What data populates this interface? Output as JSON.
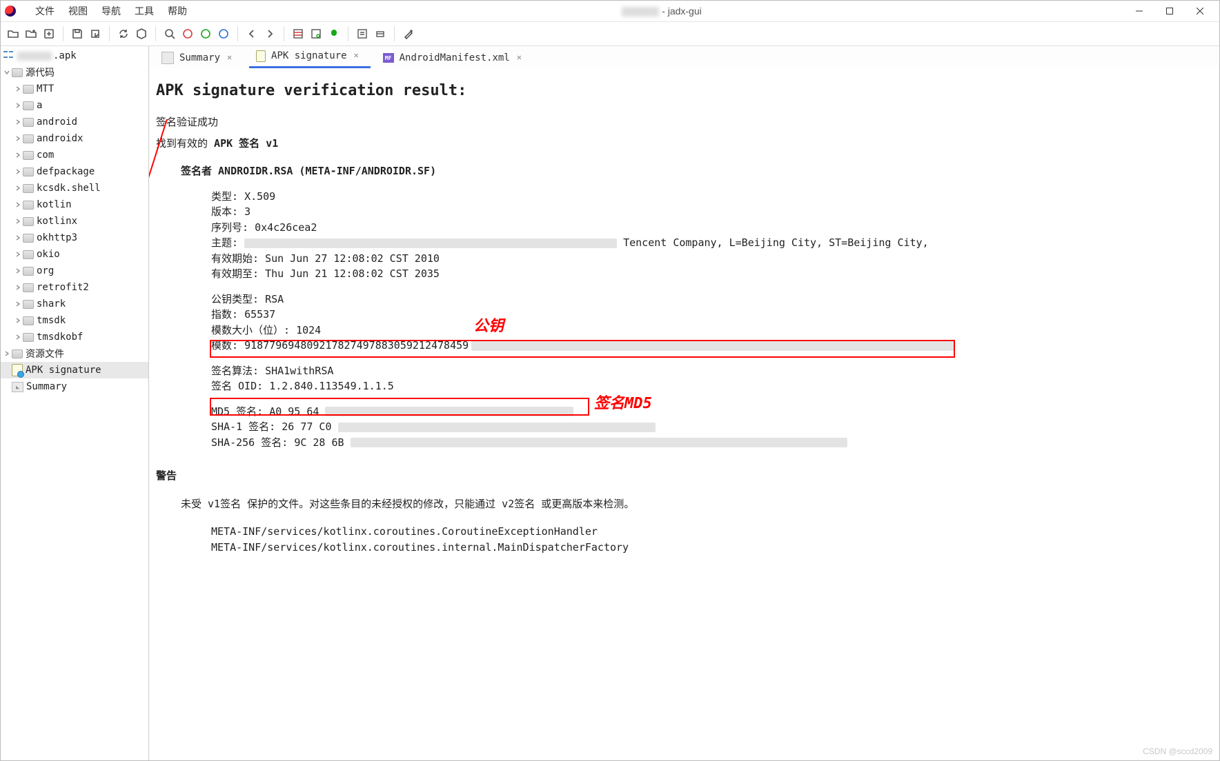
{
  "window": {
    "title_suffix": " - jadx-gui"
  },
  "menu": [
    "文件",
    "视图",
    "导航",
    "工具",
    "帮助"
  ],
  "tree": {
    "root_label": ".apk",
    "source_label": "源代码",
    "packages": [
      "MTT",
      "a",
      "android",
      "androidx",
      "com",
      "defpackage",
      "kcsdk.shell",
      "kotlin",
      "kotlinx",
      "okhttp3",
      "okio",
      "org",
      "retrofit2",
      "shark",
      "tmsdk",
      "tmsdkobf"
    ],
    "resources_label": "资源文件",
    "apk_sig_label": "APK signature",
    "summary_label": "Summary"
  },
  "tabs": [
    {
      "label": "Summary",
      "icon": "sum"
    },
    {
      "label": "APK signature",
      "icon": "cert",
      "active": true
    },
    {
      "label": "AndroidManifest.xml",
      "icon": "mf"
    }
  ],
  "page": {
    "title": "APK signature verification result:",
    "verify_ok": "签名验证成功",
    "found_prefix": "找到有效的 ",
    "found_bold": "APK 签名 v1",
    "signer_prefix": "签名者 ",
    "signer_name": "ANDROIDR.RSA (META-INF/ANDROIDR.SF)",
    "fields": {
      "type_label": "类型: ",
      "type_val": "X.509",
      "ver_label": "版本: ",
      "ver_val": "3",
      "serial_label": "序列号: ",
      "serial_val": "0x4c26cea2",
      "subject_label": "主题: ",
      "subject_tail": " Tencent Company, L=Beijing City, ST=Beijing City,",
      "valid_from_label": "有效期始: ",
      "valid_from_val": "Sun Jun 27 12:08:02 CST 2010",
      "valid_to_label": "有效期至: ",
      "valid_to_val": "Thu Jun 21 12:08:02 CST 2035",
      "pk_type_label": "公钥类型: ",
      "pk_type_val": "RSA",
      "exp_label": "指数: ",
      "exp_val": "65537",
      "mod_size_label": "模数大小（位）: ",
      "mod_size_val": "1024",
      "mod_label": "模数: ",
      "mod_val": "918779694809217827497883059212478459",
      "sig_alg_label": "签名算法: ",
      "sig_alg_val": "SHA1withRSA",
      "sig_oid_label": "签名 OID: ",
      "sig_oid_val": "1.2.840.113549.1.1.5",
      "md5_label": "MD5 签名: ",
      "md5_val": "A0 95 64 ",
      "sha1_label": "SHA-1 签名: ",
      "sha1_val": "26 77 C0 ",
      "sha256_label": "SHA-256 签名: ",
      "sha256_val": "9C 28 6B "
    },
    "annot_pubkey": "公钥",
    "annot_md5": "签名MD5",
    "warning_hd": "警告",
    "warning_text": "未受 v1签名 保护的文件。对这些条目的未经授权的修改，只能通过 v2签名 或更高版本来检测。",
    "warning_files": [
      "META-INF/services/kotlinx.coroutines.CoroutineExceptionHandler",
      "META-INF/services/kotlinx.coroutines.internal.MainDispatcherFactory"
    ],
    "watermark": "CSDN @sccd2009"
  }
}
